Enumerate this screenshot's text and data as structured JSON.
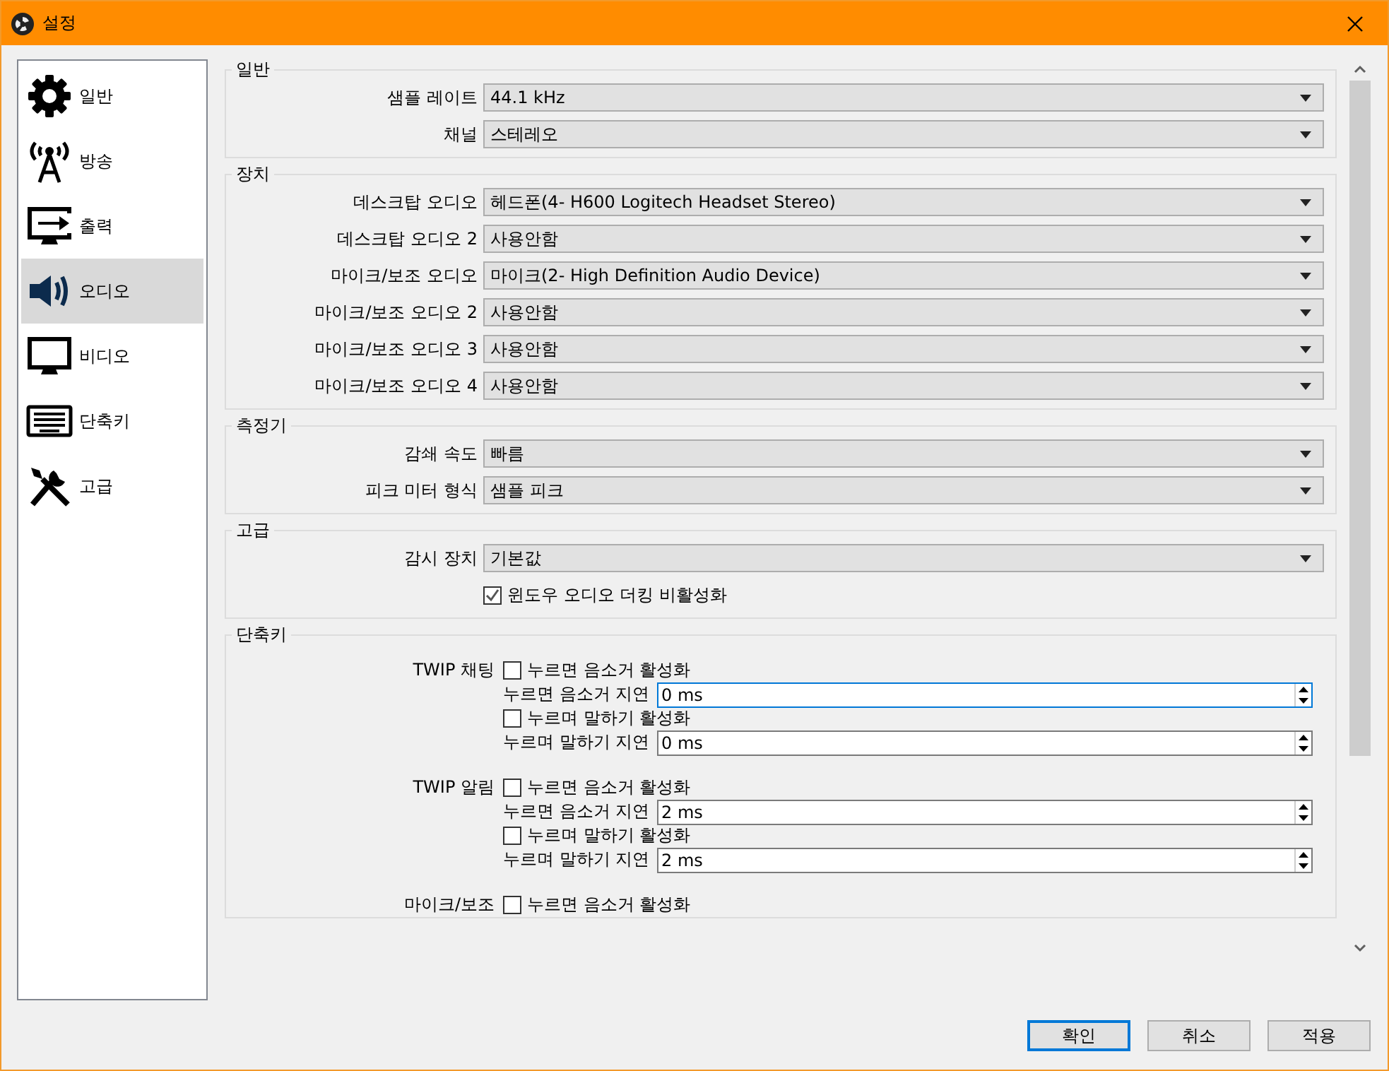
{
  "window": {
    "title": "설정"
  },
  "sidebar": {
    "items": [
      {
        "kind": "gear",
        "label": "일반",
        "selected": false
      },
      {
        "kind": "antenna",
        "label": "방송",
        "selected": false
      },
      {
        "kind": "output",
        "label": "출력",
        "selected": false
      },
      {
        "kind": "speaker",
        "label": "오디오",
        "selected": true
      },
      {
        "kind": "monitor",
        "label": "비디오",
        "selected": false
      },
      {
        "kind": "keyboard",
        "label": "단축키",
        "selected": false
      },
      {
        "kind": "tools",
        "label": "고급",
        "selected": false
      }
    ]
  },
  "sections": [
    {
      "title": "일반",
      "rows": [
        {
          "kind": "combo",
          "label": "샘플 레이트",
          "value": "44.1 kHz"
        },
        {
          "kind": "combo",
          "label": "채널",
          "value": "스테레오"
        }
      ]
    },
    {
      "title": "장치",
      "rows": [
        {
          "kind": "combo",
          "label": "데스크탑 오디오",
          "value": "헤드폰(4- H600 Logitech Headset Stereo)"
        },
        {
          "kind": "combo",
          "label": "데스크탑 오디오 2",
          "value": "사용안함"
        },
        {
          "kind": "combo",
          "label": "마이크/보조 오디오",
          "value": "마이크(2- High Definition Audio Device)"
        },
        {
          "kind": "combo",
          "label": "마이크/보조 오디오 2",
          "value": "사용안함"
        },
        {
          "kind": "combo",
          "label": "마이크/보조 오디오 3",
          "value": "사용안함"
        },
        {
          "kind": "combo",
          "label": "마이크/보조 오디오 4",
          "value": "사용안함"
        }
      ]
    },
    {
      "title": "측정기",
      "rows": [
        {
          "kind": "combo",
          "label": "감쇄 속도",
          "value": "빠름"
        },
        {
          "kind": "combo",
          "label": "피크 미터 형식",
          "value": "샘플 피크"
        }
      ]
    },
    {
      "title": "고급",
      "rows": [
        {
          "kind": "combo",
          "label": "감시 장치",
          "value": "기본값"
        },
        {
          "kind": "checkbox",
          "label": "윈도우 오디오 더킹 비활성화",
          "checked": true
        }
      ]
    }
  ],
  "hotkeys": {
    "title": "단축키",
    "groups": [
      {
        "name": "TWIP 채팅",
        "rows": [
          {
            "kind": "checkbox",
            "label": "누르면 음소거 활성화",
            "checked": false
          },
          {
            "kind": "spin",
            "label": "누르면 음소거 지연",
            "value": "0 ms",
            "focused": true
          },
          {
            "kind": "checkbox",
            "label": "누르며 말하기 활성화",
            "checked": false
          },
          {
            "kind": "spin",
            "label": "누르며 말하기 지연",
            "value": "0 ms",
            "focused": false
          }
        ]
      },
      {
        "name": "TWIP 알림",
        "rows": [
          {
            "kind": "checkbox",
            "label": "누르면 음소거 활성화",
            "checked": false
          },
          {
            "kind": "spin",
            "label": "누르면 음소거 지연",
            "value": "2 ms",
            "focused": false
          },
          {
            "kind": "checkbox",
            "label": "누르며 말하기 활성화",
            "checked": false
          },
          {
            "kind": "spin",
            "label": "누르며 말하기 지연",
            "value": "2 ms",
            "focused": false
          }
        ]
      },
      {
        "name": "마이크/보조",
        "rows": [
          {
            "kind": "checkbox",
            "label": "누르면 음소거 활성화",
            "checked": false
          }
        ]
      }
    ]
  },
  "buttons": [
    {
      "label": "확인",
      "default": true
    },
    {
      "label": "취소",
      "default": false
    },
    {
      "label": "적용",
      "default": false
    }
  ]
}
